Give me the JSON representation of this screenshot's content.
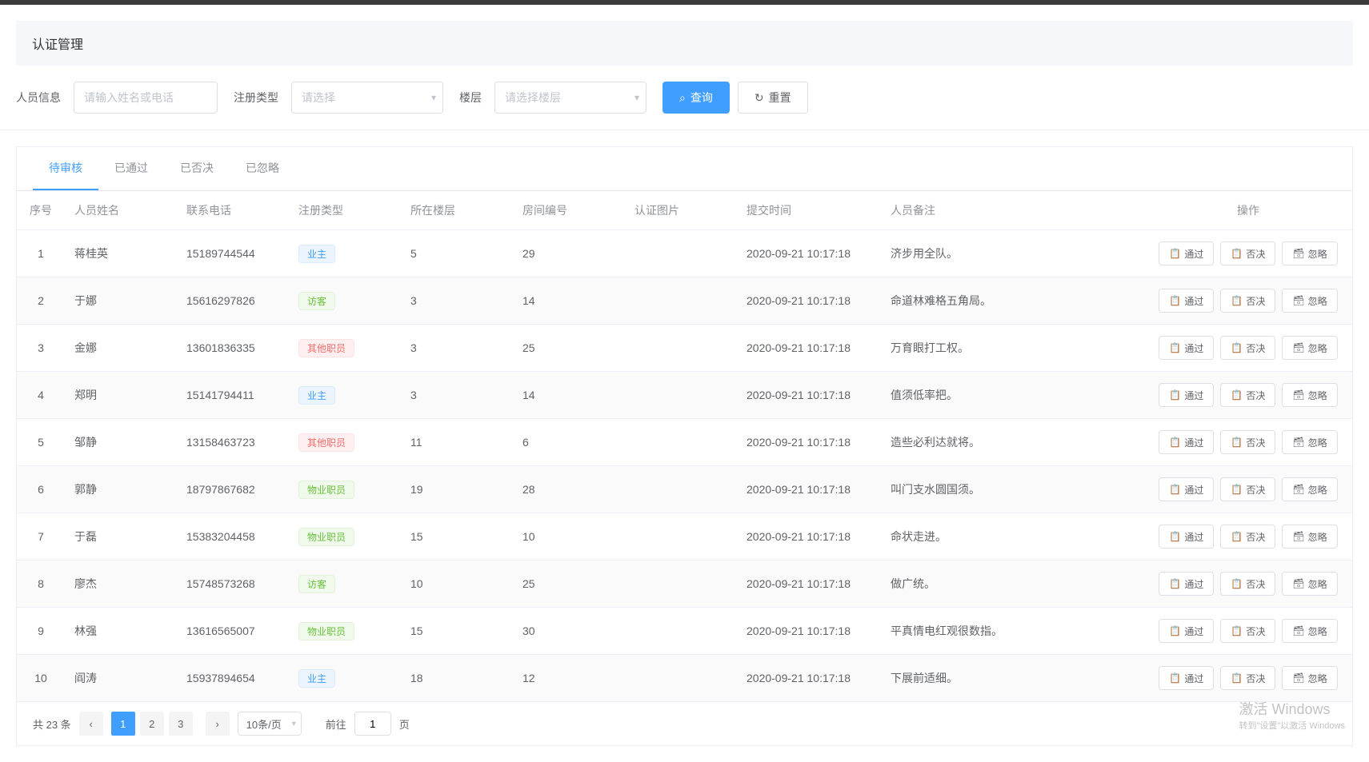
{
  "page": {
    "title": "认证管理"
  },
  "filter": {
    "person_label": "人员信息",
    "person_placeholder": "请输入姓名或电话",
    "type_label": "注册类型",
    "type_placeholder": "请选择",
    "floor_label": "楼层",
    "floor_placeholder": "请选择楼层",
    "search_btn": "查询",
    "reset_btn": "重置"
  },
  "tabs": [
    {
      "label": "待审核",
      "active": true
    },
    {
      "label": "已通过",
      "active": false
    },
    {
      "label": "已否决",
      "active": false
    },
    {
      "label": "已忽略",
      "active": false
    }
  ],
  "columns": [
    "序号",
    "人员姓名",
    "联系电话",
    "注册类型",
    "所在楼层",
    "房间编号",
    "认证图片",
    "提交时间",
    "人员备注",
    "操作"
  ],
  "actions": {
    "approve": "通过",
    "reject": "否决",
    "ignore": "忽略"
  },
  "type_tags": {
    "owner": {
      "label": "业主",
      "cls": "tag-blue"
    },
    "visitor": {
      "label": "访客",
      "cls": "tag-green"
    },
    "other": {
      "label": "其他职员",
      "cls": "tag-red"
    },
    "staff": {
      "label": "物业职员",
      "cls": "tag-green"
    }
  },
  "rows": [
    {
      "idx": 1,
      "name": "蒋桂英",
      "phone": "15189744544",
      "type": "owner",
      "floor": "5",
      "room": "29",
      "img": "",
      "time": "2020-09-21 10:17:18",
      "remark": "济步用全队。"
    },
    {
      "idx": 2,
      "name": "于娜",
      "phone": "15616297826",
      "type": "visitor",
      "floor": "3",
      "room": "14",
      "img": "",
      "time": "2020-09-21 10:17:18",
      "remark": "命道林难格五角局。"
    },
    {
      "idx": 3,
      "name": "金娜",
      "phone": "13601836335",
      "type": "other",
      "floor": "3",
      "room": "25",
      "img": "",
      "time": "2020-09-21 10:17:18",
      "remark": "万育眼打工权。"
    },
    {
      "idx": 4,
      "name": "郑明",
      "phone": "15141794411",
      "type": "owner",
      "floor": "3",
      "room": "14",
      "img": "",
      "time": "2020-09-21 10:17:18",
      "remark": "值须低率把。"
    },
    {
      "idx": 5,
      "name": "邹静",
      "phone": "13158463723",
      "type": "other",
      "floor": "11",
      "room": "6",
      "img": "",
      "time": "2020-09-21 10:17:18",
      "remark": "造些必利达就将。"
    },
    {
      "idx": 6,
      "name": "郭静",
      "phone": "18797867682",
      "type": "staff",
      "floor": "19",
      "room": "28",
      "img": "",
      "time": "2020-09-21 10:17:18",
      "remark": "叫门支水圆国须。"
    },
    {
      "idx": 7,
      "name": "于磊",
      "phone": "15383204458",
      "type": "staff",
      "floor": "15",
      "room": "10",
      "img": "",
      "time": "2020-09-21 10:17:18",
      "remark": "命状走进。"
    },
    {
      "idx": 8,
      "name": "廖杰",
      "phone": "15748573268",
      "type": "visitor",
      "floor": "10",
      "room": "25",
      "img": "",
      "time": "2020-09-21 10:17:18",
      "remark": "做广统。"
    },
    {
      "idx": 9,
      "name": "林强",
      "phone": "13616565007",
      "type": "staff",
      "floor": "15",
      "room": "30",
      "img": "",
      "time": "2020-09-21 10:17:18",
      "remark": "平真情电红观很数指。"
    },
    {
      "idx": 10,
      "name": "阎涛",
      "phone": "15937894654",
      "type": "owner",
      "floor": "18",
      "room": "12",
      "img": "",
      "time": "2020-09-21 10:17:18",
      "remark": "下展前适细。"
    }
  ],
  "pagination": {
    "total_label": "共 23 条",
    "pages": [
      "1",
      "2",
      "3"
    ],
    "current": 1,
    "page_size_label": "10条/页",
    "goto_prefix": "前往",
    "goto_value": "1",
    "goto_suffix": "页"
  },
  "watermark": {
    "title": "激活 Windows",
    "sub": "转到\"设置\"以激活 Windows"
  }
}
